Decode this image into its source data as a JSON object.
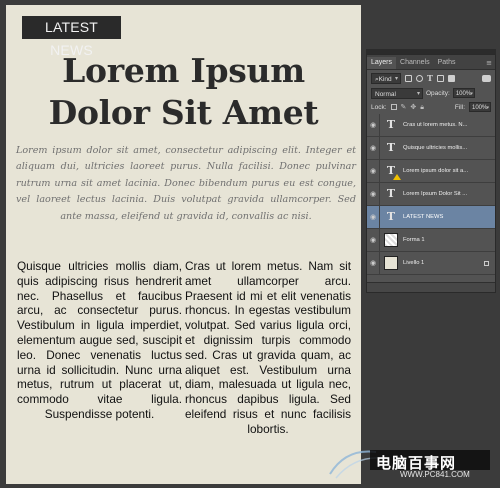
{
  "canvas": {
    "tag": "LATEST NEWS",
    "headline_line1": "Lorem Ipsum",
    "headline_line2": "Dolor Sit Amet",
    "lead": "Lorem ipsum dolor sit amet, consectetur adipiscing elit. Integer et aliquam dui, ultricies laoreet purus. Nulla facilisi. Donec pulvinar rutrum urna sit amet lacinia. Donec bibendum purus eu est congue, vel laoreet lectus lacinia. Duis volutpat gravida ullamcorper. Sed ante massa, eleifend ut gravida id, convallis ac nisi.",
    "col_left": "Quisque ultricies mollis diam, quis adipiscing risus hendrerit nec. Phasellus et faucibus arcu, ac consectetur purus. Vestibulum in ligula imperdiet, elementum augue sed, suscipit leo. Donec venenatis luctus urna id sollicitudin. Nunc urna metus, rutrum ut placerat ut, commodo vitae ligula. Suspendisse potenti.",
    "col_right": "Cras ut lorem metus. Nam sit amet ullamcorper arcu. Praesent id mi et elit venenatis rhoncus. In egestas vestibulum volutpat. Sed varius ligula orci, et dignissim turpis commodo sed. Cras ut gravida quam, ac aliquet est. Vestibulum urna diam, malesuada ut ligula nec, rhoncus dapibus ligula. Sed eleifend risus et nunc facilisis lobortis."
  },
  "panel": {
    "tabs": [
      "Layers",
      "Channels",
      "Paths"
    ],
    "filter_kind": "Kind",
    "blend_mode": "Normal",
    "opacity_label": "Opacity:",
    "opacity_value": "100%",
    "lock_label": "Lock:",
    "fill_label": "Fill:",
    "fill_value": "100%",
    "layers": [
      {
        "name": "Cras ut lorem metus. N...",
        "kind": "text",
        "warn": false,
        "selected": false
      },
      {
        "name": "Quisque ultricies mollis...",
        "kind": "text",
        "warn": false,
        "selected": false
      },
      {
        "name": "Lorem ipsum dolor sit a...",
        "kind": "text",
        "warn": true,
        "selected": false
      },
      {
        "name": "Lorem Ipsum Dolor Sit ...",
        "kind": "text",
        "warn": false,
        "selected": false
      },
      {
        "name": "LATEST NEWS",
        "kind": "text",
        "warn": false,
        "selected": true
      },
      {
        "name": "Forma 1",
        "kind": "shape",
        "warn": false,
        "selected": false
      },
      {
        "name": "Livello 1",
        "kind": "fill",
        "warn": false,
        "selected": false
      }
    ]
  },
  "watermark": {
    "text": "电脑百事网",
    "sub": "WWW.PC841.COM"
  }
}
